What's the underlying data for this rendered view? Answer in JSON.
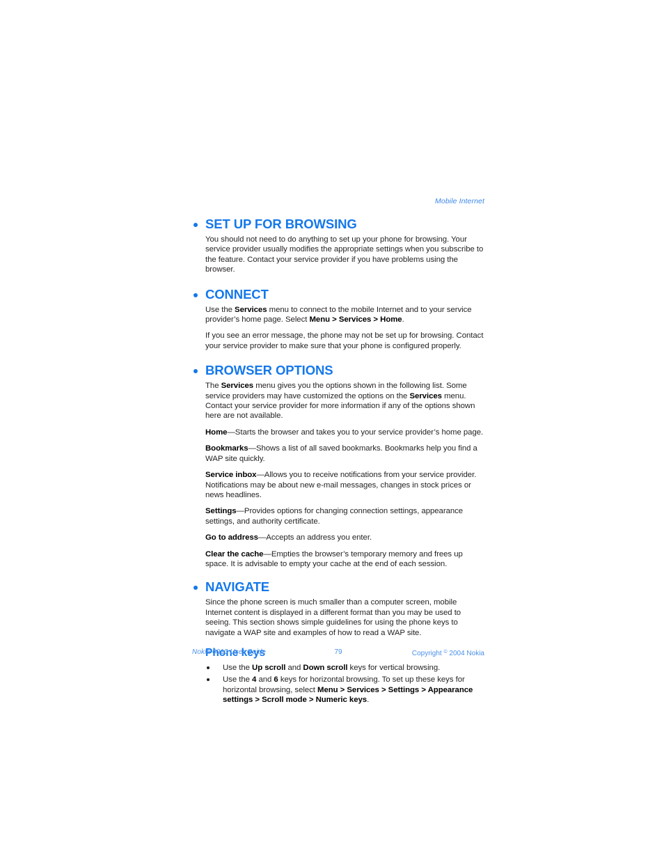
{
  "document": {
    "running_header": "Mobile Internet",
    "page_number": "79",
    "footer_left": "Nokia 6010 User Guide",
    "footer_right_pre": "Copyright",
    "footer_right_symbol": "©",
    "footer_right_post": "2004 Nokia",
    "colors": {
      "heading_blue": "#1478ea",
      "footer_blue": "#4a90e8",
      "body_text": "#231f20",
      "page_background": "#ffffff"
    }
  },
  "sections": {
    "set_up_for_browsing": {
      "heading": "SET UP FOR BROWSING",
      "paragraph": "You should not need to do anything to set up your phone for browsing. Your service provider usually modifies the appropriate settings when you subscribe to the feature. Contact your service provider if you have problems using the browser."
    },
    "connect": {
      "heading": "CONNECT",
      "p1_a": "Use the ",
      "p1_b1": "Services",
      "p1_b": " menu to connect to the mobile Internet and to your service provider’s home page. Select ",
      "p1_b2": "Menu > Services > Home",
      "p1_c": ".",
      "p2": "If you see an error message, the phone may not be set up for browsing. Contact your service provider to make sure that your phone is configured properly."
    },
    "browser_options": {
      "heading": "BROWSER OPTIONS",
      "intro_a": "The ",
      "intro_b1": "Services",
      "intro_b": " menu gives you the options shown in the following list. Some service providers may have customized the options on the ",
      "intro_b2": "Services",
      "intro_c": " menu. Contact your service provider for more information if any of the options shown here are not available.",
      "options": [
        {
          "term": "Home",
          "dash": "—",
          "description": "Starts the browser and takes you to your service provider’s home page."
        },
        {
          "term": "Bookmarks",
          "dash": "—",
          "description": "Shows a list of all saved bookmarks. Bookmarks help you find a WAP site quickly."
        },
        {
          "term": "Service inbox",
          "dash": "—",
          "description": "Allows you to receive notifications from your service provider. Notifications may be about new e-mail messages, changes in stock prices or news headlines."
        },
        {
          "term": "Settings",
          "dash": "—",
          "description": "Provides options for changing connection settings, appearance settings, and authority certificate."
        },
        {
          "term": "Go to address",
          "dash": "—",
          "description": "Accepts an address you enter."
        },
        {
          "term": "Clear the cache",
          "dash": "—",
          "description": "Empties the browser’s temporary memory and frees up space. It is advisable to empty your cache at the end of each session."
        }
      ]
    },
    "navigate": {
      "heading": "NAVIGATE",
      "paragraph": "Since the phone screen is much smaller than a computer screen, mobile Internet content is displayed in a different format than you may be used to seeing. This section shows simple guidelines for using the phone keys to navigate a WAP site and examples of how to read a WAP site.",
      "subheading": "Phone keys",
      "bullets": [
        {
          "t1": "Use the ",
          "b1": "Up scroll",
          "t2": " and ",
          "b2": "Down scroll",
          "t3": " keys for vertical browsing."
        },
        {
          "t1": "Use the ",
          "b1": "4",
          "t2": " and ",
          "b2": "6",
          "t3": " keys for horizontal browsing. To set up these keys for horizontal browsing, select ",
          "b3": "Menu > Services > Settings > Appearance settings > Scroll mode > Numeric keys",
          "t4": "."
        }
      ]
    }
  }
}
